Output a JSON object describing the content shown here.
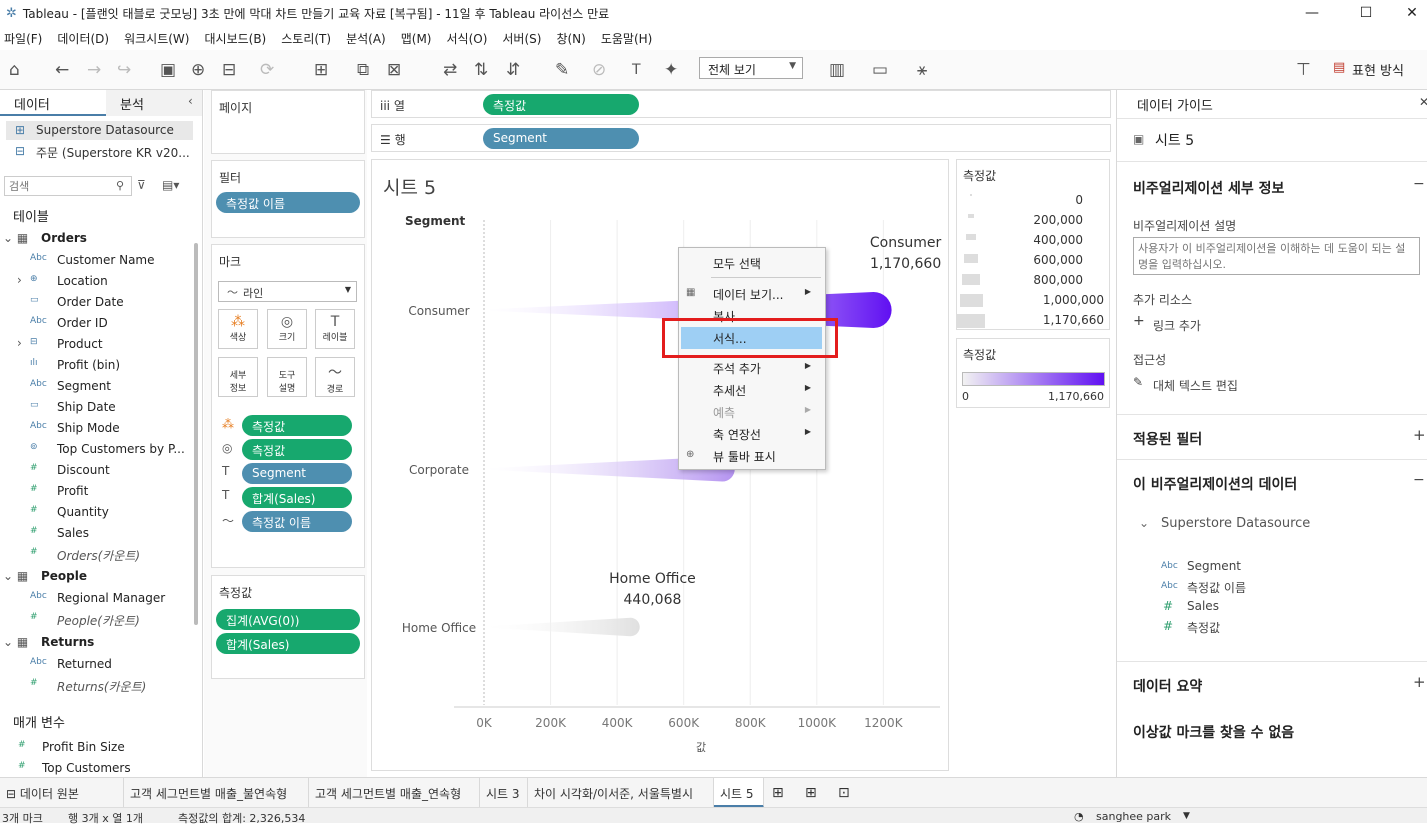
{
  "window": {
    "title": "Tableau - [플랜잇 태블로 굿모닝] 3초 만에 막대 차트 만들기 교육 자료 [복구됨] - 11일 후 Tableau 라이선스 만료"
  },
  "menu": [
    "파일(F)",
    "데이터(D)",
    "워크시트(W)",
    "대시보드(B)",
    "스토리(T)",
    "분석(A)",
    "맵(M)",
    "서식(O)",
    "서버(S)",
    "창(N)",
    "도움말(H)"
  ],
  "toolbar": {
    "fit_select": "전체 보기",
    "show_me": "표현 방식"
  },
  "left_panel": {
    "tab_data": "데이터",
    "tab_analysis": "분석",
    "datasources": [
      "Superstore Datasource",
      "주문 (Superstore KR v20..."
    ],
    "search_placeholder": "검색",
    "tables_label": "테이블",
    "groups": [
      {
        "name": "Orders",
        "fields": [
          {
            "type": "Abc",
            "label": "Customer Name"
          },
          {
            "type": "geo",
            "label": "Location"
          },
          {
            "type": "date",
            "label": "Order Date"
          },
          {
            "type": "Abc",
            "label": "Order ID"
          },
          {
            "type": "hier",
            "label": "Product"
          },
          {
            "type": "bin",
            "label": "Profit (bin)"
          },
          {
            "type": "Abc",
            "label": "Segment"
          },
          {
            "type": "date",
            "label": "Ship Date"
          },
          {
            "type": "Abc",
            "label": "Ship Mode"
          },
          {
            "type": "set",
            "label": "Top Customers by P..."
          },
          {
            "type": "#",
            "label": "Discount"
          },
          {
            "type": "#",
            "label": "Profit"
          },
          {
            "type": "#",
            "label": "Quantity"
          },
          {
            "type": "#",
            "label": "Sales"
          },
          {
            "type": "#",
            "label": "Orders(카운트)"
          }
        ]
      },
      {
        "name": "People",
        "fields": [
          {
            "type": "Abc",
            "label": "Regional Manager"
          },
          {
            "type": "#",
            "label": "People(카운트)"
          }
        ]
      },
      {
        "name": "Returns",
        "fields": [
          {
            "type": "Abc",
            "label": "Returned"
          },
          {
            "type": "#",
            "label": "Returns(카운트)"
          }
        ]
      }
    ],
    "params_label": "매개 변수",
    "params": [
      "Profit Bin Size",
      "Top Customers"
    ]
  },
  "cards": {
    "pages": "페이지",
    "filters": "필터",
    "filter_pill": "측정값 이름",
    "marks": "마크",
    "mark_type": "라인",
    "mark_buttons": [
      "색상",
      "크기",
      "레이블",
      "세부\n정보",
      "도구\n설명",
      "경로"
    ],
    "mark_pills": [
      "측정값",
      "측정값",
      "Segment",
      "합계(Sales)",
      "측정값 이름"
    ],
    "measure_values": "측정값",
    "mv_pills": [
      "집계(AVG(0))",
      "합계(Sales)"
    ]
  },
  "shelves": {
    "columns_label": "열",
    "columns_pill": "측정값",
    "rows_label": "행",
    "rows_pill": "Segment"
  },
  "viz": {
    "sheet_title": "시트 5",
    "row_header": "Segment",
    "x_label": "값"
  },
  "chart_data": {
    "type": "bar",
    "categories": [
      "Consumer",
      "Corporate",
      "Home Office"
    ],
    "values": [
      1170660,
      715779,
      440068
    ],
    "labels": [
      "Consumer\n1,170,660",
      "",
      "Home Office\n440,068"
    ],
    "xticks": [
      "0K",
      "200K",
      "400K",
      "600K",
      "800K",
      "1000K",
      "1200K"
    ],
    "xlim": [
      0,
      1280000
    ],
    "xlabel": "값",
    "colors": {
      "low": "#e8e8e8",
      "high": "#6010f2"
    }
  },
  "legend_size": {
    "title": "측정값",
    "entries": [
      "0",
      "200,000",
      "400,000",
      "600,000",
      "800,000",
      "1,000,000",
      "1,170,660"
    ]
  },
  "legend_color": {
    "title": "측정값",
    "min": "0",
    "max": "1,170,660"
  },
  "context_menu": {
    "items": [
      "모두 선택",
      "데이터 보기...",
      "복사",
      "서식...",
      "주석 추가",
      "추세선",
      "예측",
      "축 연장선",
      "뷰 툴바 표시"
    ]
  },
  "right_panel": {
    "title": "데이터 가이드",
    "sheet": "시트 5",
    "viz_details": "비주얼리제이션 세부 정보",
    "desc_label": "비주얼리제이션 설명",
    "desc_placeholder": "사용자가 이 비주얼리제이션을 이해하는 데 도움이 되는 설명을 입력하십시오.",
    "resources_label": "추가 리소스",
    "add_link": "링크 추가",
    "access_label": "접근성",
    "alt_text": "대체 텍스트 편집",
    "applied_filters": "적용된 필터",
    "viz_data": "이 비주얼리제이션의 데이터",
    "datasource": "Superstore Datasource",
    "fields": [
      "Segment",
      "측정값 이름",
      "Sales",
      "측정값"
    ],
    "summary": "데이터 요약",
    "outliers": "이상값 마크를 찾을 수 없음"
  },
  "bottom_tabs": [
    "데이터 원본",
    "고객 세그먼트별 매출_불연속형",
    "고객 세그먼트별 매출_연속형",
    "시트 3",
    "차이 시각화/이서준, 서울특별시",
    "시트 5"
  ],
  "status": {
    "marks": "3개 마크",
    "rows_cols": "행 3개 x 열 1개",
    "sum": "측정값의 합계: 2,326,534",
    "user": "sanghee park"
  }
}
